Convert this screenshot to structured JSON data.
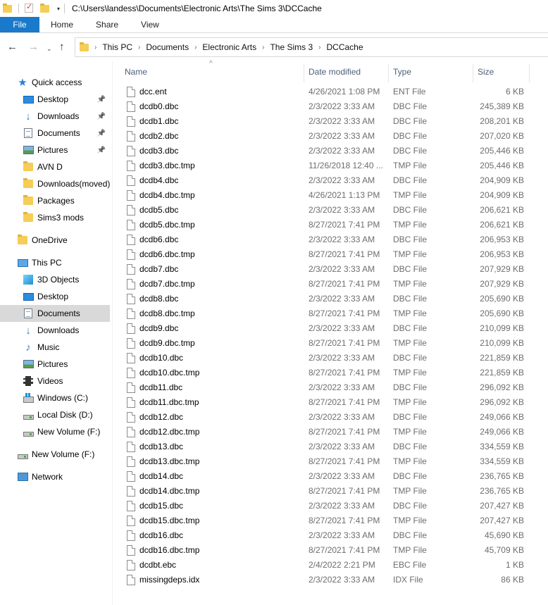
{
  "titlebar": {
    "path": "C:\\Users\\landess\\Documents\\Electronic Arts\\The Sims 3\\DCCache"
  },
  "ribbon": {
    "tabs": [
      {
        "label": "File"
      },
      {
        "label": "Home"
      },
      {
        "label": "Share"
      },
      {
        "label": "View"
      }
    ]
  },
  "nav": {
    "back": "←",
    "forward": "→",
    "recent": "⌄",
    "up": "↑"
  },
  "address": {
    "crumbs": [
      "This PC",
      "Documents",
      "Electronic Arts",
      "The Sims 3",
      "DCCache"
    ]
  },
  "sidebar": {
    "items": [
      {
        "label": "Quick access",
        "icon": "star-icon"
      },
      {
        "label": "Desktop",
        "icon": "desktop-icon",
        "pinned": true
      },
      {
        "label": "Downloads",
        "icon": "download-icon",
        "pinned": true
      },
      {
        "label": "Documents",
        "icon": "documents-icon",
        "pinned": true
      },
      {
        "label": "Pictures",
        "icon": "pictures-icon",
        "pinned": true
      },
      {
        "label": "AVN D",
        "icon": "folder-icon"
      },
      {
        "label": "Downloads(moved)",
        "icon": "folder-icon"
      },
      {
        "label": "Packages",
        "icon": "folder-icon"
      },
      {
        "label": "Sims3 mods",
        "icon": "folder-icon"
      },
      {
        "label": "OneDrive",
        "icon": "folder-icon"
      },
      {
        "label": "This PC",
        "icon": "computer-icon"
      },
      {
        "label": "3D Objects",
        "icon": "cube-icon"
      },
      {
        "label": "Desktop",
        "icon": "desktop-icon"
      },
      {
        "label": "Documents",
        "icon": "documents-icon",
        "selected": true
      },
      {
        "label": "Downloads",
        "icon": "download-icon"
      },
      {
        "label": "Music",
        "icon": "music-icon"
      },
      {
        "label": "Pictures",
        "icon": "pictures-icon"
      },
      {
        "label": "Videos",
        "icon": "video-icon"
      },
      {
        "label": "Windows (C:)",
        "icon": "windows-drive-icon"
      },
      {
        "label": "Local Disk (D:)",
        "icon": "drive-icon"
      },
      {
        "label": "New Volume (F:)",
        "icon": "drive-icon"
      },
      {
        "label": "New Volume (F:)",
        "icon": "drive-icon"
      },
      {
        "label": "Network",
        "icon": "network-icon"
      }
    ]
  },
  "columns": {
    "name": "Name",
    "date": "Date modified",
    "type": "Type",
    "size": "Size"
  },
  "files": [
    {
      "name": "dcc.ent",
      "date": "4/26/2021 1:08 PM",
      "type": "ENT File",
      "size": "6 KB"
    },
    {
      "name": "dcdb0.dbc",
      "date": "2/3/2022 3:33 AM",
      "type": "DBC File",
      "size": "245,389 KB"
    },
    {
      "name": "dcdb1.dbc",
      "date": "2/3/2022 3:33 AM",
      "type": "DBC File",
      "size": "208,201 KB"
    },
    {
      "name": "dcdb2.dbc",
      "date": "2/3/2022 3:33 AM",
      "type": "DBC File",
      "size": "207,020 KB"
    },
    {
      "name": "dcdb3.dbc",
      "date": "2/3/2022 3:33 AM",
      "type": "DBC File",
      "size": "205,446 KB"
    },
    {
      "name": "dcdb3.dbc.tmp",
      "date": "11/26/2018 12:40 ...",
      "type": "TMP File",
      "size": "205,446 KB"
    },
    {
      "name": "dcdb4.dbc",
      "date": "2/3/2022 3:33 AM",
      "type": "DBC File",
      "size": "204,909 KB"
    },
    {
      "name": "dcdb4.dbc.tmp",
      "date": "4/26/2021 1:13 PM",
      "type": "TMP File",
      "size": "204,909 KB"
    },
    {
      "name": "dcdb5.dbc",
      "date": "2/3/2022 3:33 AM",
      "type": "DBC File",
      "size": "206,621 KB"
    },
    {
      "name": "dcdb5.dbc.tmp",
      "date": "8/27/2021 7:41 PM",
      "type": "TMP File",
      "size": "206,621 KB"
    },
    {
      "name": "dcdb6.dbc",
      "date": "2/3/2022 3:33 AM",
      "type": "DBC File",
      "size": "206,953 KB"
    },
    {
      "name": "dcdb6.dbc.tmp",
      "date": "8/27/2021 7:41 PM",
      "type": "TMP File",
      "size": "206,953 KB"
    },
    {
      "name": "dcdb7.dbc",
      "date": "2/3/2022 3:33 AM",
      "type": "DBC File",
      "size": "207,929 KB"
    },
    {
      "name": "dcdb7.dbc.tmp",
      "date": "8/27/2021 7:41 PM",
      "type": "TMP File",
      "size": "207,929 KB"
    },
    {
      "name": "dcdb8.dbc",
      "date": "2/3/2022 3:33 AM",
      "type": "DBC File",
      "size": "205,690 KB"
    },
    {
      "name": "dcdb8.dbc.tmp",
      "date": "8/27/2021 7:41 PM",
      "type": "TMP File",
      "size": "205,690 KB"
    },
    {
      "name": "dcdb9.dbc",
      "date": "2/3/2022 3:33 AM",
      "type": "DBC File",
      "size": "210,099 KB"
    },
    {
      "name": "dcdb9.dbc.tmp",
      "date": "8/27/2021 7:41 PM",
      "type": "TMP File",
      "size": "210,099 KB"
    },
    {
      "name": "dcdb10.dbc",
      "date": "2/3/2022 3:33 AM",
      "type": "DBC File",
      "size": "221,859 KB"
    },
    {
      "name": "dcdb10.dbc.tmp",
      "date": "8/27/2021 7:41 PM",
      "type": "TMP File",
      "size": "221,859 KB"
    },
    {
      "name": "dcdb11.dbc",
      "date": "2/3/2022 3:33 AM",
      "type": "DBC File",
      "size": "296,092 KB"
    },
    {
      "name": "dcdb11.dbc.tmp",
      "date": "8/27/2021 7:41 PM",
      "type": "TMP File",
      "size": "296,092 KB"
    },
    {
      "name": "dcdb12.dbc",
      "date": "2/3/2022 3:33 AM",
      "type": "DBC File",
      "size": "249,066 KB"
    },
    {
      "name": "dcdb12.dbc.tmp",
      "date": "8/27/2021 7:41 PM",
      "type": "TMP File",
      "size": "249,066 KB"
    },
    {
      "name": "dcdb13.dbc",
      "date": "2/3/2022 3:33 AM",
      "type": "DBC File",
      "size": "334,559 KB"
    },
    {
      "name": "dcdb13.dbc.tmp",
      "date": "8/27/2021 7:41 PM",
      "type": "TMP File",
      "size": "334,559 KB"
    },
    {
      "name": "dcdb14.dbc",
      "date": "2/3/2022 3:33 AM",
      "type": "DBC File",
      "size": "236,765 KB"
    },
    {
      "name": "dcdb14.dbc.tmp",
      "date": "8/27/2021 7:41 PM",
      "type": "TMP File",
      "size": "236,765 KB"
    },
    {
      "name": "dcdb15.dbc",
      "date": "2/3/2022 3:33 AM",
      "type": "DBC File",
      "size": "207,427 KB"
    },
    {
      "name": "dcdb15.dbc.tmp",
      "date": "8/27/2021 7:41 PM",
      "type": "TMP File",
      "size": "207,427 KB"
    },
    {
      "name": "dcdb16.dbc",
      "date": "2/3/2022 3:33 AM",
      "type": "DBC File",
      "size": "45,690 KB"
    },
    {
      "name": "dcdb16.dbc.tmp",
      "date": "8/27/2021 7:41 PM",
      "type": "TMP File",
      "size": "45,709 KB"
    },
    {
      "name": "dcdbt.ebc",
      "date": "2/4/2022 2:21 PM",
      "type": "EBC File",
      "size": "1 KB"
    },
    {
      "name": "missingdeps.idx",
      "date": "2/3/2022 3:33 AM",
      "type": "IDX File",
      "size": "86 KB"
    }
  ]
}
